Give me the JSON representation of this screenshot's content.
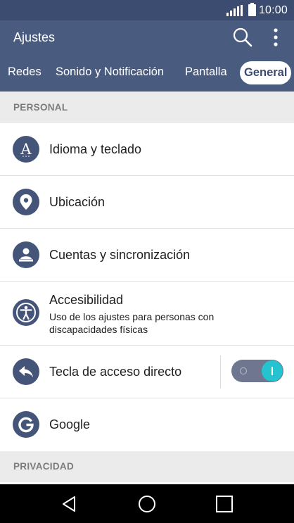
{
  "status_bar": {
    "time": "10:00"
  },
  "app_bar": {
    "title": "Ajustes"
  },
  "tabs": [
    {
      "label": "Redes"
    },
    {
      "label": "Sonido y Notificación"
    },
    {
      "label": "Pantalla"
    },
    {
      "label": "General",
      "active": true
    }
  ],
  "sections": {
    "personal": "PERSONAL",
    "privacy": "PRIVACIDAD"
  },
  "items": {
    "language": {
      "label": "Idioma y teclado",
      "icon": "language-icon"
    },
    "location": {
      "label": "Ubicación",
      "icon": "location-pin-icon"
    },
    "accounts": {
      "label": "Cuentas y sincronización",
      "icon": "accounts-sync-icon"
    },
    "accessibility": {
      "label": "Accesibilidad",
      "description": "Uso de los ajustes para personas con discapacidades físicas",
      "icon": "accessibility-icon"
    },
    "shortcut_key": {
      "label": "Tecla de acceso directo",
      "icon": "back-arrow-icon",
      "toggle_on": true
    },
    "google": {
      "label": "Google",
      "icon": "google-icon"
    }
  },
  "colors": {
    "status_bar": "#3c4c70",
    "app_bar": "#4a5b80",
    "icon_bg": "#45557a",
    "toggle_on": "#25c3cf",
    "section_bg": "#ebebeb"
  }
}
